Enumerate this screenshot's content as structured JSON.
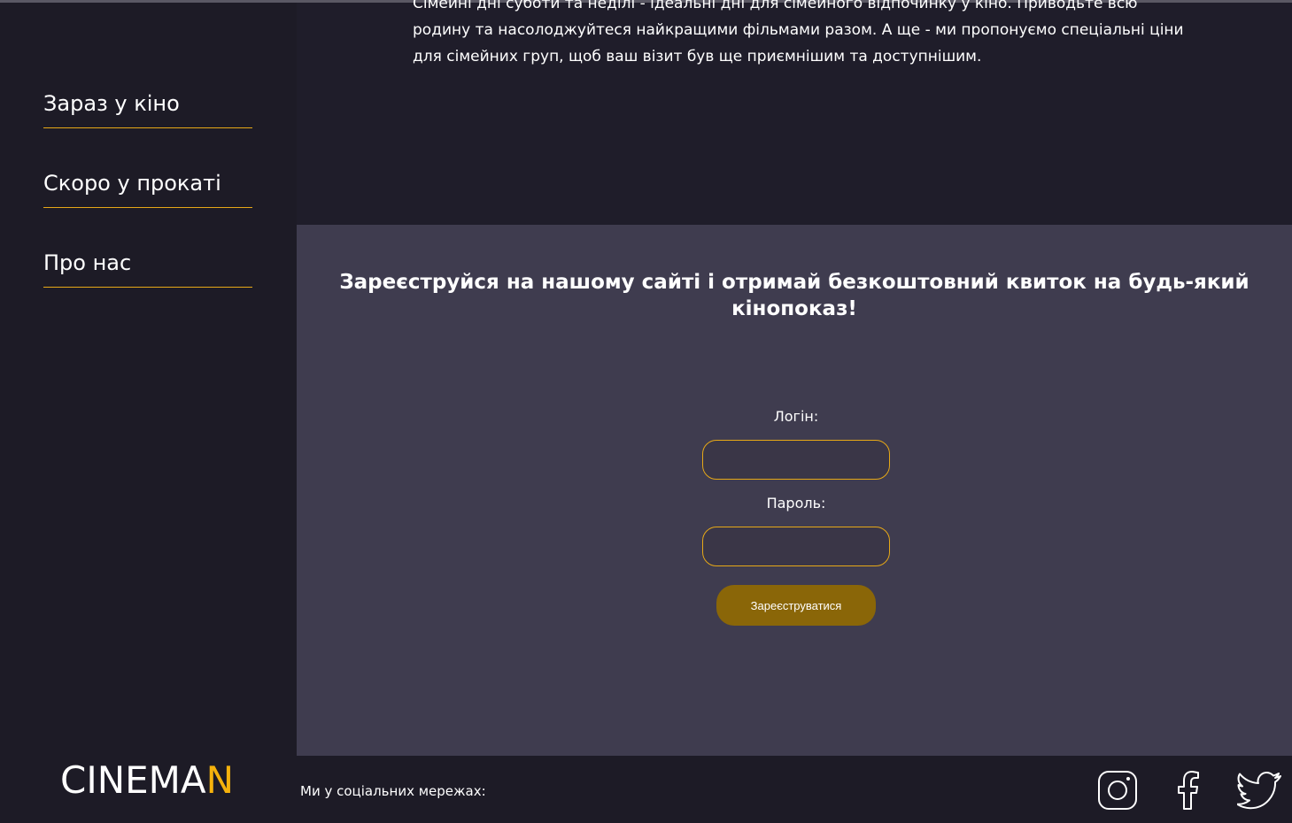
{
  "sidebar": {
    "items": [
      {
        "label": "Зараз у кіно"
      },
      {
        "label": "Скоро у прокаті"
      },
      {
        "label": "Про нас"
      }
    ]
  },
  "logo": {
    "main": "CINEMA",
    "accent": "N"
  },
  "intro": {
    "text": "Сімейні дні суботи та неділі - ідеальні дні для сімейного відпочинку у кіно. Приводьте всю родину та насолоджуйтеся найкращими фільмами разом. А ще - ми пропонуємо спеціальні ціни для сімейних груп, щоб ваш візит був ще приємнішим та доступнішим."
  },
  "registration": {
    "title": "Зареєструйся на нашому сайті і отримай безкоштовний квиток на будь-який кінопоказ!",
    "login_label": "Логін:",
    "login_value": "",
    "password_label": "Пароль:",
    "password_value": "",
    "submit_label": "Зареєструватися"
  },
  "footer": {
    "social_label": "Ми у соціальних мережах:",
    "icons": [
      "instagram-icon",
      "facebook-icon",
      "twitter-icon"
    ]
  },
  "colors": {
    "accent": "#e6a817",
    "button": "#8a6608",
    "panel": "#3f3c4f",
    "background": "#1d1b26"
  }
}
